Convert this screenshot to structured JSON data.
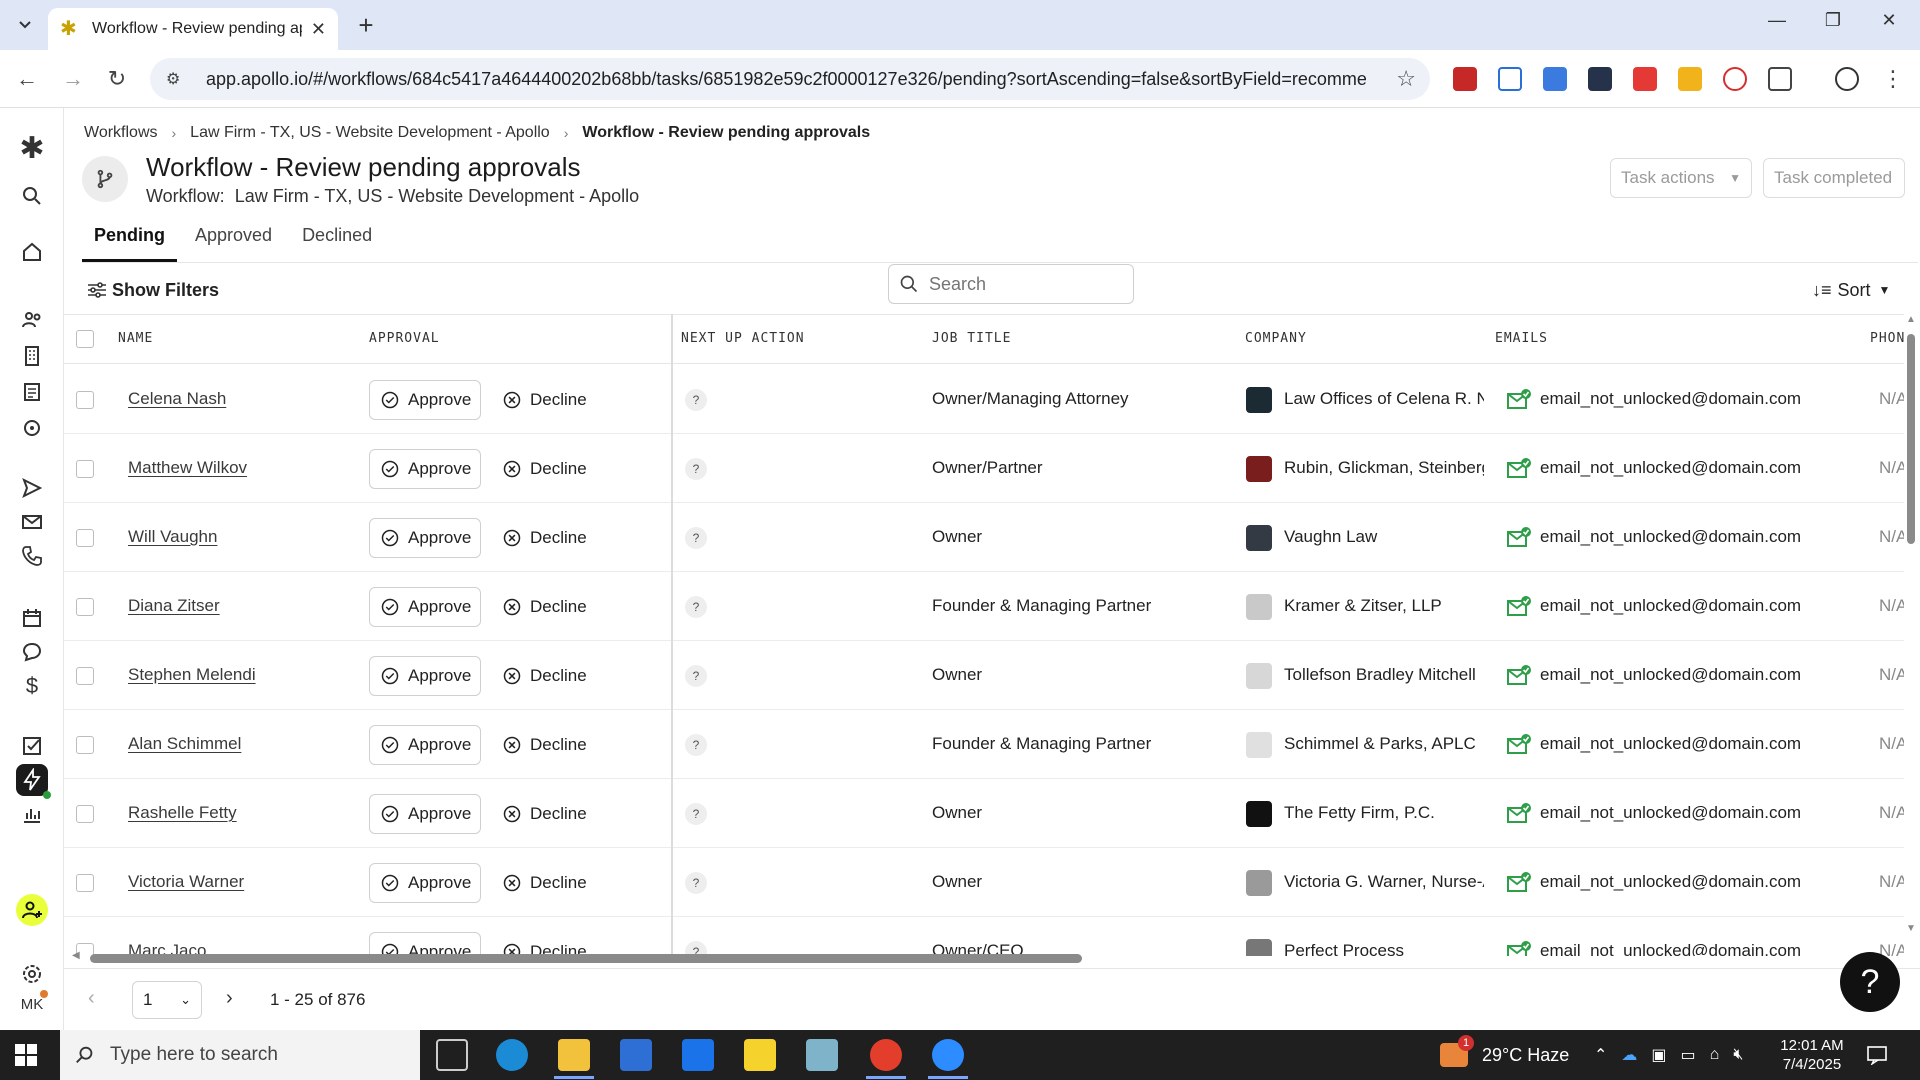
{
  "browser": {
    "tab_title": "Workflow - Review pending app",
    "url": "app.apollo.io/#/workflows/684c5417a4644400202b68bb/tasks/6851982e59c2f0000127e326/pending?sortAscending=false&sortByField=recommendati..."
  },
  "breadcrumb": {
    "items": [
      "Workflows",
      "Law Firm - TX, US - Website Development - Apollo",
      "Workflow - Review pending approvals"
    ]
  },
  "header": {
    "title": "Workflow - Review pending approvals",
    "subtitle_label": "Workflow:",
    "subtitle_value": "Law Firm - TX, US - Website Development - Apollo",
    "task_actions": "Task actions",
    "task_completed": "Task completed"
  },
  "tabs": [
    "Pending",
    "Approved",
    "Declined"
  ],
  "toolbar": {
    "filters_label": "Show Filters",
    "search_placeholder": "Search",
    "sort_label": "Sort"
  },
  "table": {
    "columns": [
      "NAME",
      "APPROVAL",
      "NEXT UP ACTION",
      "JOB TITLE",
      "COMPANY",
      "EMAILS",
      "PHON"
    ],
    "approve_label": "Approve",
    "decline_label": "Decline",
    "next_up_value": "?",
    "rows": [
      {
        "name": "Celena Nash",
        "job": "Owner/Managing Attorney",
        "company": "Law Offices of Celena R. Nash",
        "email": "email_not_unlocked@domain.com",
        "phone": "N/A",
        "logo_color": "#1c2a33"
      },
      {
        "name": "Matthew Wilkov",
        "job": "Owner/Partner",
        "company": "Rubin, Glickman, Steinberg",
        "email": "email_not_unlocked@domain.com",
        "phone": "N/A",
        "logo_color": "#7a1d1d"
      },
      {
        "name": "Will Vaughn",
        "job": "Owner",
        "company": "Vaughn Law",
        "email": "email_not_unlocked@domain.com",
        "phone": "N/A",
        "logo_color": "#333a44"
      },
      {
        "name": "Diana Zitser",
        "job": "Founder & Managing Partner",
        "company": "Kramer & Zitser, LLP",
        "email": "email_not_unlocked@domain.com",
        "phone": "N/A",
        "logo_color": "#c9c9c9"
      },
      {
        "name": "Stephen Melendi",
        "job": "Owner",
        "company": "Tollefson Bradley Mitchell",
        "email": "email_not_unlocked@domain.com",
        "phone": "N/A",
        "logo_color": "#d7d7d7"
      },
      {
        "name": "Alan Schimmel",
        "job": "Founder & Managing Partner",
        "company": "Schimmel & Parks, APLC",
        "email": "email_not_unlocked@domain.com",
        "phone": "N/A",
        "logo_color": "#e0e0e0"
      },
      {
        "name": "Rashelle Fetty",
        "job": "Owner",
        "company": "The Fetty Firm, P.C.",
        "email": "email_not_unlocked@domain.com",
        "phone": "N/A",
        "logo_color": "#111111"
      },
      {
        "name": "Victoria Warner",
        "job": "Owner",
        "company": "Victoria G. Warner, Nurse-Attorney",
        "email": "email_not_unlocked@domain.com",
        "phone": "N/A",
        "logo_color": "#9a9a9a"
      },
      {
        "name": "Marc Jaco",
        "job": "Owner/CEO",
        "company": "Perfect Process",
        "email": "email_not_unlocked@domain.com",
        "phone": "N/A",
        "logo_color": "#777777"
      }
    ]
  },
  "pagination": {
    "page": "1",
    "range": "1 - 25 of 876"
  },
  "user_initials": "MK",
  "taskbar": {
    "search_placeholder": "Type here to search",
    "weather": "29°C  Haze",
    "time": "12:01 AM",
    "date": "7/4/2025",
    "notification_count": "1"
  },
  "colors": {
    "accent_yellow": "#e8ff3a",
    "email_green": "#2e9e48",
    "chrome_bg": "#dfe7f6"
  }
}
